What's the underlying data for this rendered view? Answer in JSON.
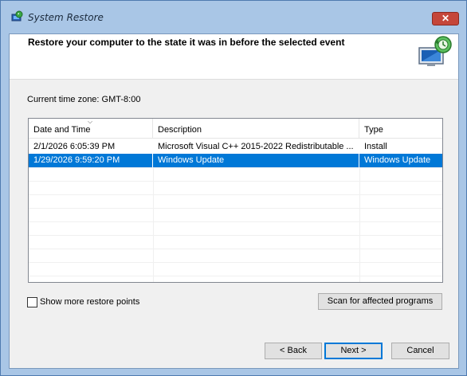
{
  "window": {
    "title": "System Restore",
    "close_label": "✕"
  },
  "header": {
    "title": "Restore your computer to the state it was in before the selected event"
  },
  "timezone_text": "Current time zone: GMT-8:00",
  "table": {
    "columns": [
      "Date and Time",
      "Description",
      "Type"
    ],
    "rows": [
      {
        "date": "2/1/2026 6:05:39 PM",
        "description": "Microsoft Visual C++ 2015-2022 Redistributable ...",
        "type": "Install",
        "selected": false
      },
      {
        "date": "1/29/2026 9:59:20 PM",
        "description": "Windows Update",
        "type": "Windows Update",
        "selected": true
      }
    ]
  },
  "show_more_label": "Show more restore points",
  "show_more_checked": false,
  "buttons": {
    "scan": "Scan for affected programs",
    "back": "< Back",
    "next": "Next >",
    "cancel": "Cancel"
  },
  "icons": {
    "title": "system-restore-icon",
    "header": "system-restore-monitor-icon",
    "sort": "sort-arrow-icon"
  },
  "colors": {
    "selection": "#0078d7",
    "frame": "#a9c6e6",
    "close": "#c5463a"
  }
}
